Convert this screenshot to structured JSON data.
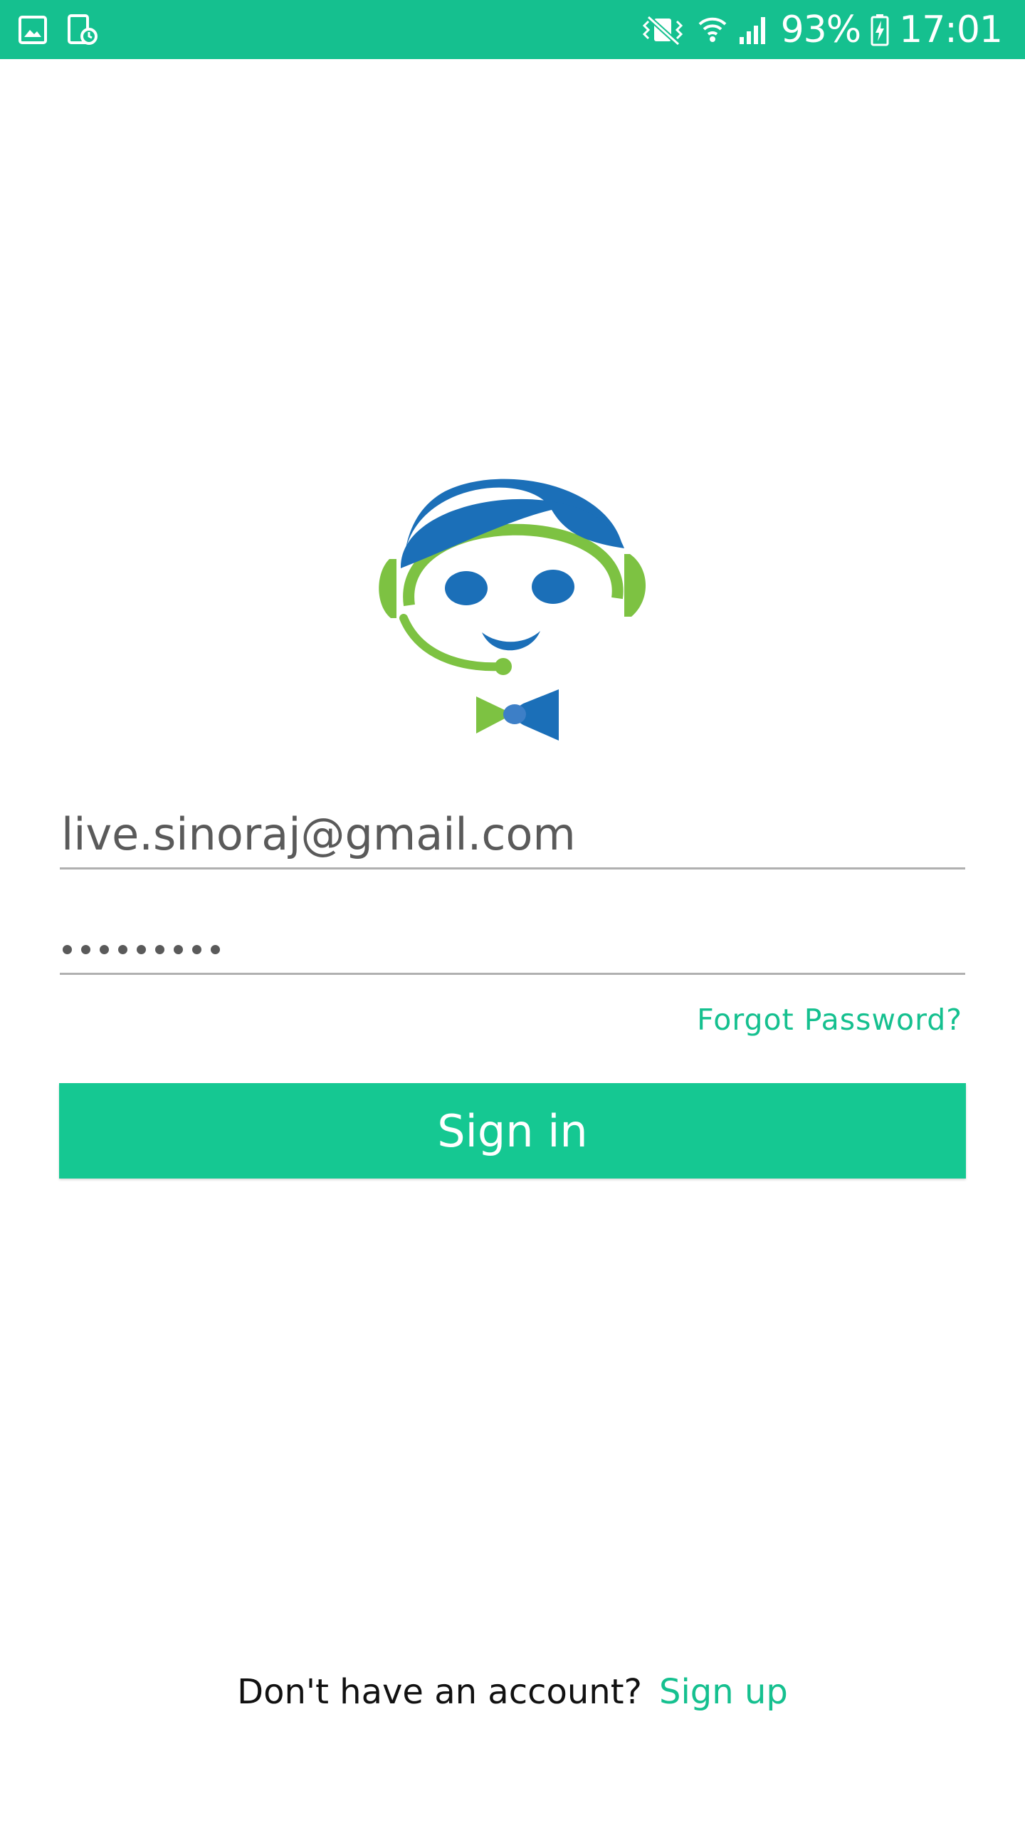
{
  "colors": {
    "accent": "#15c08f",
    "status_bar": "#15c08f",
    "logo_green": "#7dc242",
    "logo_blue": "#1b6fb8"
  },
  "status_bar": {
    "battery": "93%",
    "time": "17:01",
    "left_icons": [
      "image-notification-icon",
      "screenshot-notification-icon"
    ],
    "right_icons": [
      "vibrate-mute-icon",
      "wifi-icon",
      "signal-icon",
      "battery-charging-icon"
    ]
  },
  "logo": {
    "icon": "support-agent-headset-logo"
  },
  "login_form": {
    "email_value": "live.sinoraj@gmail.com",
    "password_mask": "•••••••••",
    "forgot_password_label": "Forgot Password?",
    "signin_label": "Sign in"
  },
  "footer": {
    "no_account_text": "Don't have an account?",
    "signup_label": "Sign up"
  }
}
